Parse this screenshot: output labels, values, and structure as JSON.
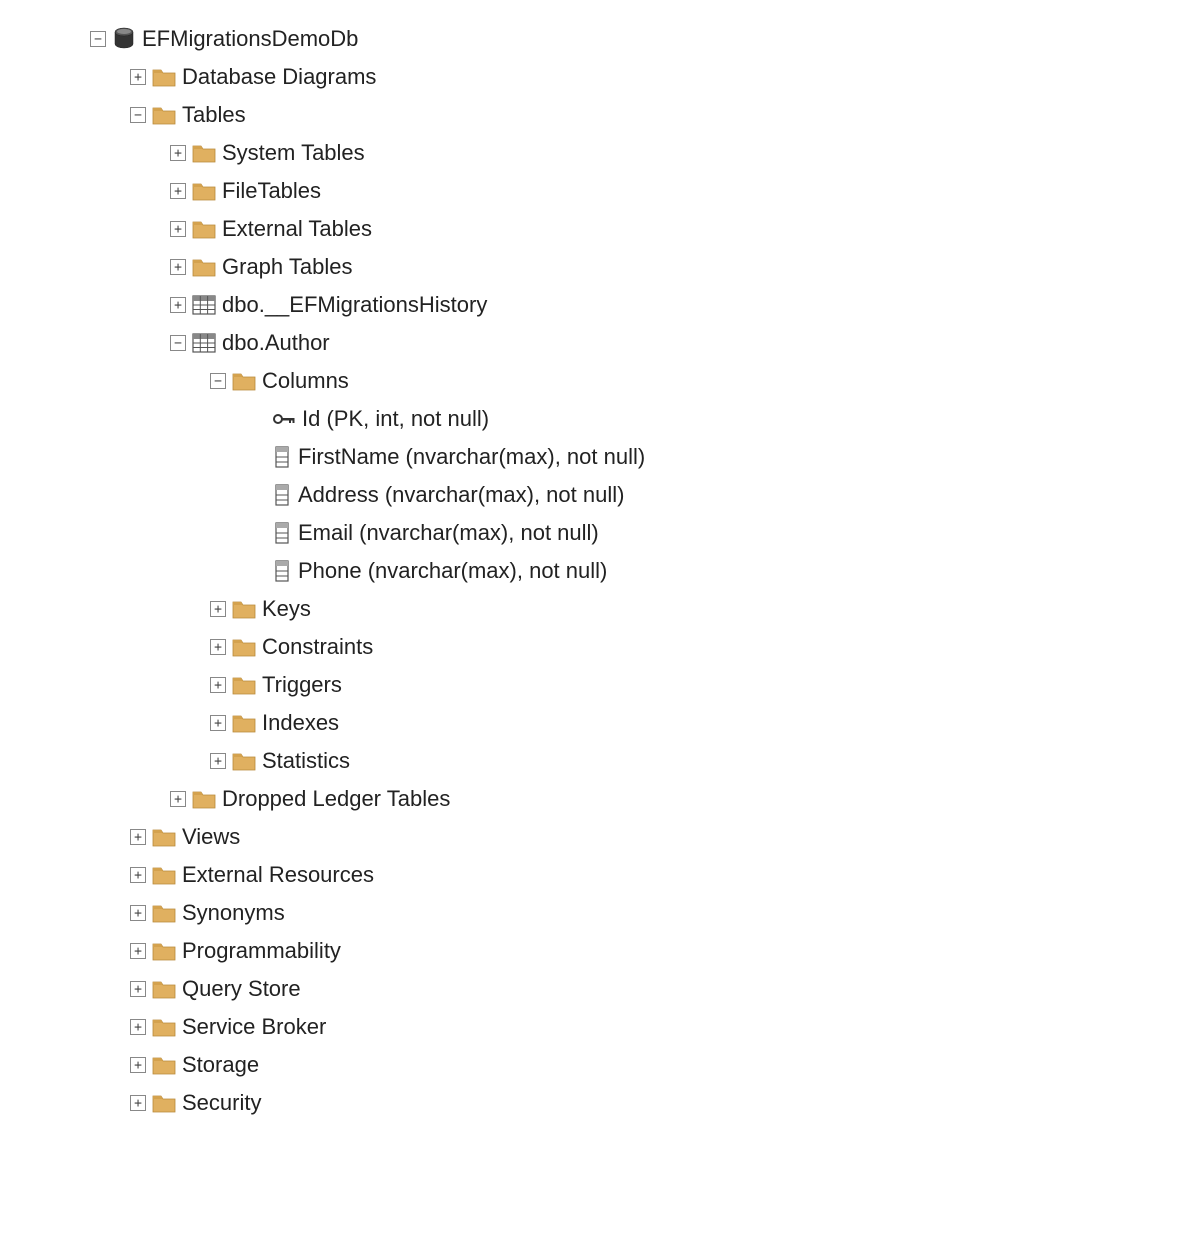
{
  "tree": {
    "database": {
      "label": "EFMigrationsDemoDb",
      "children": {
        "database_diagrams": "Database Diagrams",
        "tables": {
          "label": "Tables",
          "children": {
            "system_tables": "System Tables",
            "file_tables": "FileTables",
            "external_tables": "External Tables",
            "graph_tables": "Graph Tables",
            "ef_migrations_history": "dbo.__EFMigrationsHistory",
            "author": {
              "label": "dbo.Author",
              "children": {
                "columns": {
                  "label": "Columns",
                  "items": {
                    "id": "Id (PK, int, not null)",
                    "first_name": "FirstName (nvarchar(max), not null)",
                    "address": "Address (nvarchar(max), not null)",
                    "email": "Email (nvarchar(max), not null)",
                    "phone": "Phone (nvarchar(max), not null)"
                  }
                },
                "keys": "Keys",
                "constraints": "Constraints",
                "triggers": "Triggers",
                "indexes": "Indexes",
                "statistics": "Statistics"
              }
            },
            "dropped_ledger_tables": "Dropped Ledger Tables"
          }
        },
        "views": "Views",
        "external_resources": "External Resources",
        "synonyms": "Synonyms",
        "programmability": "Programmability",
        "query_store": "Query Store",
        "service_broker": "Service Broker",
        "storage": "Storage",
        "security": "Security"
      }
    }
  }
}
